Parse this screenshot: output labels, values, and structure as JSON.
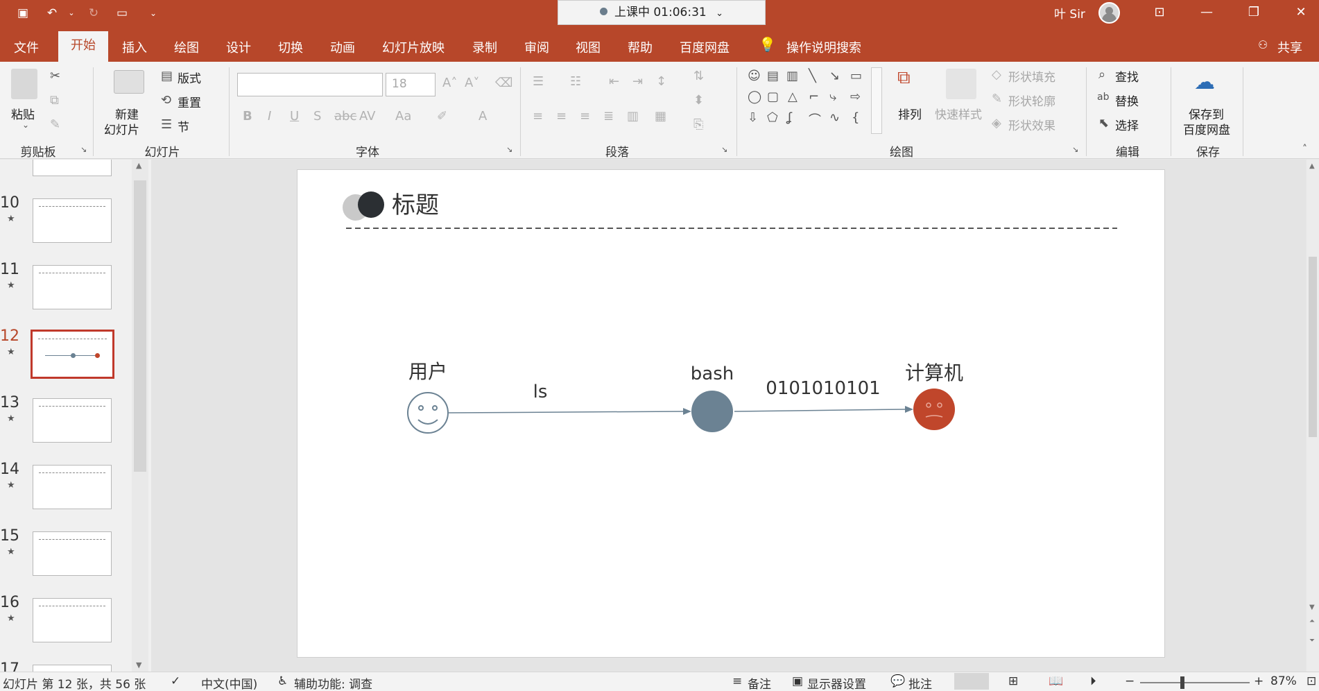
{
  "titlebar": {
    "recording": "上课中 01:06:31",
    "user": "叶 Sir"
  },
  "menu": {
    "tabs": [
      "文件",
      "开始",
      "插入",
      "绘图",
      "设计",
      "切换",
      "动画",
      "幻灯片放映",
      "录制",
      "审阅",
      "视图",
      "帮助",
      "百度网盘"
    ],
    "active": "开始",
    "search": "操作说明搜索",
    "share": "共享"
  },
  "ribbon": {
    "clipboard": {
      "paste": "粘贴",
      "label": "剪贴板"
    },
    "slides": {
      "new_slide_1": "新建",
      "new_slide_2": "幻灯片",
      "layout": "版式",
      "reset": "重置",
      "section": "节",
      "label": "幻灯片"
    },
    "font": {
      "size": "18",
      "label": "字体"
    },
    "paragraph": {
      "label": "段落"
    },
    "drawing": {
      "arrange": "排列",
      "quick_styles": "快速样式",
      "fill": "形状填充",
      "outline": "形状轮廓",
      "effects": "形状效果",
      "label": "绘图"
    },
    "editing": {
      "find": "查找",
      "replace": "替换",
      "select": "选择",
      "label": "编辑"
    },
    "save": {
      "save_1": "保存到",
      "save_2": "百度网盘",
      "label": "保存"
    }
  },
  "thumbnails": [
    {
      "num": "10"
    },
    {
      "num": "11"
    },
    {
      "num": "12",
      "selected": true
    },
    {
      "num": "13"
    },
    {
      "num": "14"
    },
    {
      "num": "15"
    },
    {
      "num": "16"
    },
    {
      "num": "17"
    }
  ],
  "slide": {
    "title": "标题",
    "user_label": "用户",
    "cmd_label": "ls",
    "bash_label": "bash",
    "binary_label": "0101010101",
    "computer_label": "计算机",
    "colors": {
      "bash": "#6b8293",
      "computer": "#c0462b",
      "line": "#6b8293"
    }
  },
  "status": {
    "slide_info": "幻灯片 第 12 张，共 56 张",
    "language": "中文(中国)",
    "accessibility": "辅助功能: 调查",
    "notes": "备注",
    "display_settings": "显示器设置",
    "comments": "批注",
    "zoom": "87%"
  }
}
